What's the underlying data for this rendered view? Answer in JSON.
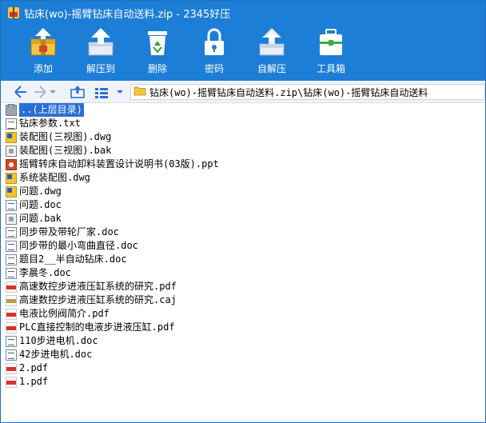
{
  "window": {
    "title": "钻床(wo)-摇臂钻床自动送料.zip - 2345好压"
  },
  "toolbar": {
    "add_label": "添加",
    "extract_label": "解压到",
    "delete_label": "删除",
    "password_label": "密码",
    "sfx_label": "自解压",
    "tools_label": "工具箱"
  },
  "address": {
    "path": "钻床(wo)-摇臂钻床自动送料.zip\\钻床(wo)-摇臂钻床自动送料"
  },
  "files": [
    {
      "name": "..(上层目录)",
      "type": "up"
    },
    {
      "name": "钻床参数.txt",
      "type": "txt"
    },
    {
      "name": "装配图(三视图).dwg",
      "type": "dwg"
    },
    {
      "name": "装配图(三视图).bak",
      "type": "bak"
    },
    {
      "name": "摇臂转床自动卸料装置设计说明书(03版).ppt",
      "type": "ppt"
    },
    {
      "name": "系统装配图.dwg",
      "type": "dwg"
    },
    {
      "name": "问题.dwg",
      "type": "dwg"
    },
    {
      "name": "问题.doc",
      "type": "doc"
    },
    {
      "name": "问题.bak",
      "type": "bak"
    },
    {
      "name": "同步带及带轮厂家.doc",
      "type": "doc"
    },
    {
      "name": "同步带的最小弯曲直径.doc",
      "type": "doc"
    },
    {
      "name": "题目2__半自动钻床.doc",
      "type": "doc"
    },
    {
      "name": "李晨冬.doc",
      "type": "doc"
    },
    {
      "name": "高速数控步进液压缸系统的研究.pdf",
      "type": "pdf"
    },
    {
      "name": "高速数控步进液压缸系统的研究.caj",
      "type": "caj"
    },
    {
      "name": "电液比例阀简介.pdf",
      "type": "pdf"
    },
    {
      "name": "PLC直接控制的电液步进液压缸.pdf",
      "type": "pdf"
    },
    {
      "name": "110步进电机.doc",
      "type": "doc"
    },
    {
      "name": "42步进电机.doc",
      "type": "doc"
    },
    {
      "name": "2.pdf",
      "type": "pdf"
    },
    {
      "name": "1.pdf",
      "type": "pdf"
    }
  ]
}
